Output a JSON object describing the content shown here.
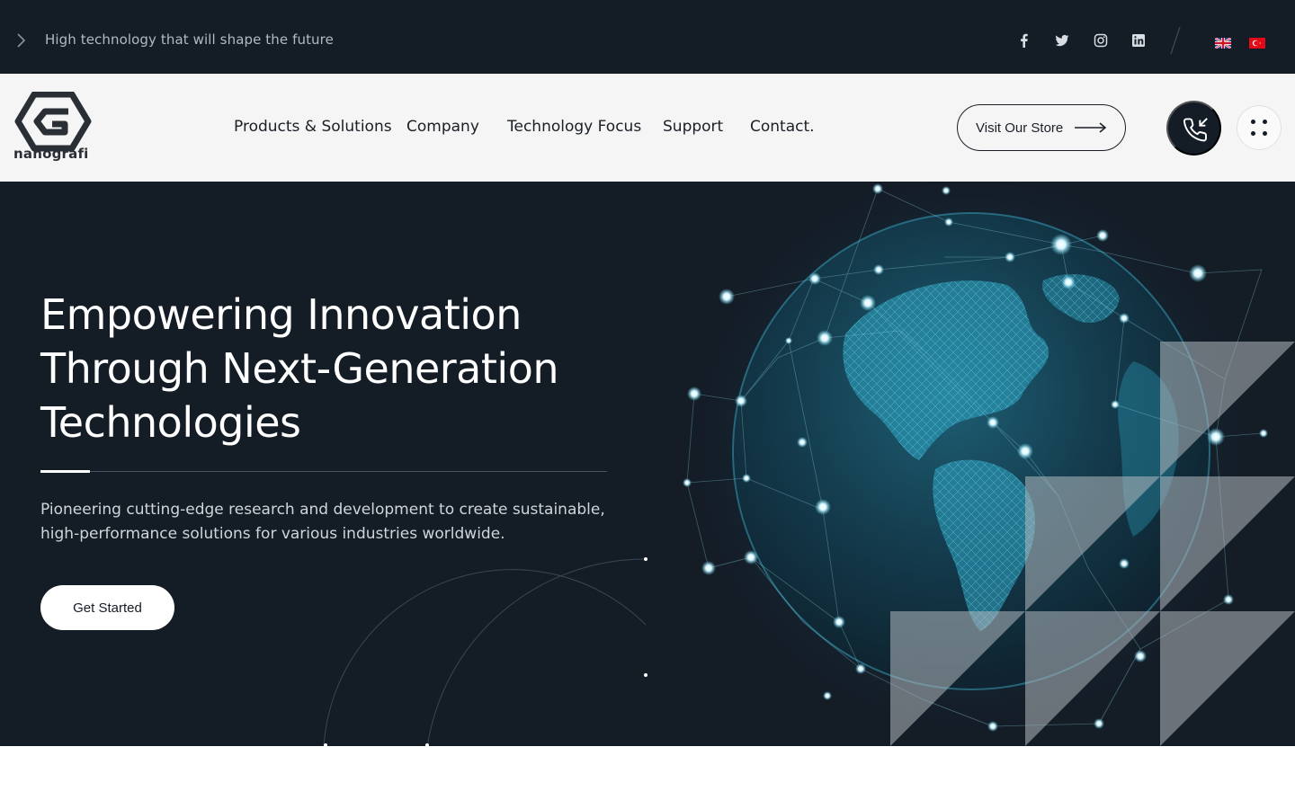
{
  "topbar": {
    "tagline": "High technology that will shape the future",
    "social": [
      "facebook-icon",
      "twitter-icon",
      "instagram-icon",
      "linkedin-icon"
    ],
    "languages": [
      "english-flag-icon",
      "turkish-flag-icon"
    ]
  },
  "header": {
    "logo_text": "nanografi",
    "nav": [
      "Products & Solutions",
      "Company",
      "Technology Focus",
      "Support",
      "Contact."
    ],
    "store_button": "Visit Our Store",
    "phone_icon": "phone-incoming-icon",
    "menu_icon": "dots-grid-icon"
  },
  "hero": {
    "title": "Empowering Innovation Through Next-Generation Technologies",
    "description": "Pioneering cutting-edge research and development to create sustainable, high-performance solutions for various industries worldwide.",
    "cta": "Get Started"
  },
  "colors": {
    "dark": "#141c26",
    "light": "#f5f5f5",
    "accent": "#5fd3ee"
  }
}
